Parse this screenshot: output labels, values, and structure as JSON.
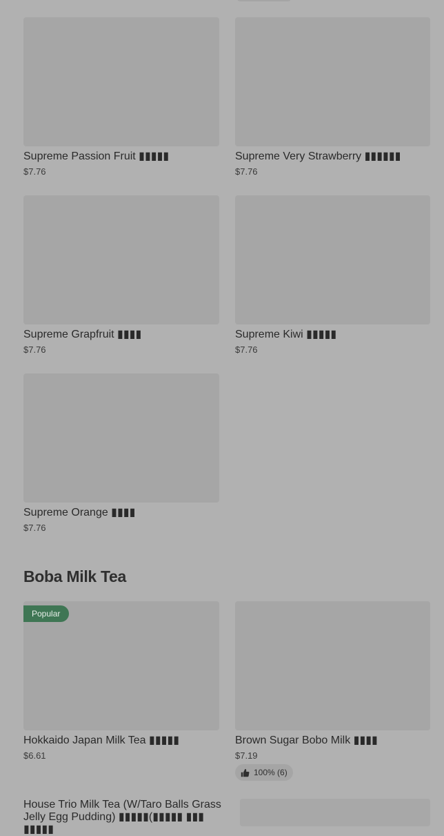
{
  "items": [
    {
      "name": "Supreme Passion Fruit ▮▮▮▮▮",
      "price": "$7.76"
    },
    {
      "name": "Supreme Very Strawberry ▮▮▮▮▮▮",
      "price": "$7.76"
    },
    {
      "name": "Supreme Grapfruit ▮▮▮▮",
      "price": "$7.76"
    },
    {
      "name": "Supreme Kiwi ▮▮▮▮▮",
      "price": "$7.76"
    },
    {
      "name": "Supreme Orange ▮▮▮▮",
      "price": "$7.76"
    }
  ],
  "section": {
    "title": "Boba Milk Tea"
  },
  "boba_items": [
    {
      "name": "Hokkaido Japan Milk Tea ▮▮▮▮▮",
      "price": "$6.61",
      "badge": "Popular"
    },
    {
      "name": "Brown Sugar Bobo Milk ▮▮▮▮",
      "price": "$7.19",
      "rating": "100% (6)",
      "rating_icon": "thumbs-up-icon"
    },
    {
      "name": "House Trio Milk Tea (W/Taro Balls Grass Jelly Egg Pudding) ▮▮▮▮▮(▮▮▮▮▮ ▮▮▮ ▮▮▮▮▮"
    }
  ]
}
